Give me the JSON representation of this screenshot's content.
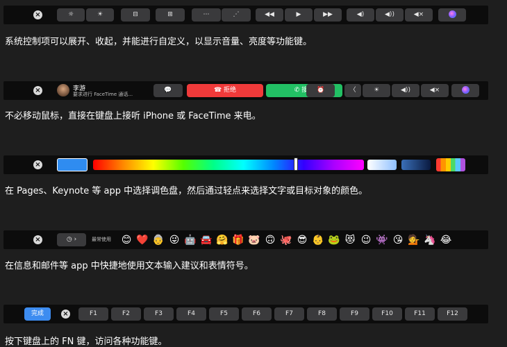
{
  "bar1": {
    "keys": [
      "☼",
      "☀",
      "⊟",
      "⊞",
      "⋯",
      "⋰",
      "◀◀",
      "▶",
      "▶▶",
      "◀)",
      "◀))",
      "◀×"
    ]
  },
  "caption1": "系统控制项可以展开、收起，并能进行自定义，以显示音量、亮度等功能键。",
  "bar2": {
    "caller_name": "李游",
    "caller_sub": "要求进行 FaceTime 通话...",
    "message_icon": "💬",
    "decline": "拒绝",
    "accept": "接受",
    "alarm_icon": "⏰",
    "chevron": "〈",
    "brightness": "☀",
    "volume": "◀))",
    "mute": "◀×"
  },
  "caption2": "不必移动鼠标，直接在键盘上接听 iPhone 或 FaceTime 来电。",
  "caption3": "在 Pages、Keynote 等 app 中选择调色盘，然后通过轻点来选择文字或目标对象的颜色。",
  "bar4": {
    "clock_icon": "◷",
    "chevron": "›",
    "frequent_label": "最常使用",
    "emojis": [
      "😊",
      "❤️",
      "👵",
      "😜",
      "🤖",
      "🚘",
      "🤗",
      "🎁",
      "🐷",
      "🙃",
      "🐙",
      "😎",
      "👶",
      "🐸",
      "😻",
      "😉",
      "👾",
      "😘",
      "💁",
      "🦄",
      "😂"
    ]
  },
  "caption4": "在信息和邮件等 app 中快捷地使用文本输入建议和表情符号。",
  "bar5": {
    "done": "完成",
    "fkeys": [
      "F1",
      "F2",
      "F3",
      "F4",
      "F5",
      "F6",
      "F7",
      "F8",
      "F9",
      "F10",
      "F11",
      "F12"
    ]
  },
  "caption5": "按下键盘上的 FN 键，访问各种功能键。",
  "colors": {
    "page_bg": "#1e1e1e",
    "bar_bg": "#0c0c0c",
    "key_bg": "#3a3a3c",
    "decline_red": "#f03a3a",
    "accept_green": "#22c064",
    "done_blue": "#3d8cf0",
    "selected_swatch": "#2f8cf0"
  },
  "icons": {
    "close": "close-icon",
    "siri": "siri-icon",
    "phone_down": "phone-down-icon",
    "phone": "phone-icon"
  }
}
